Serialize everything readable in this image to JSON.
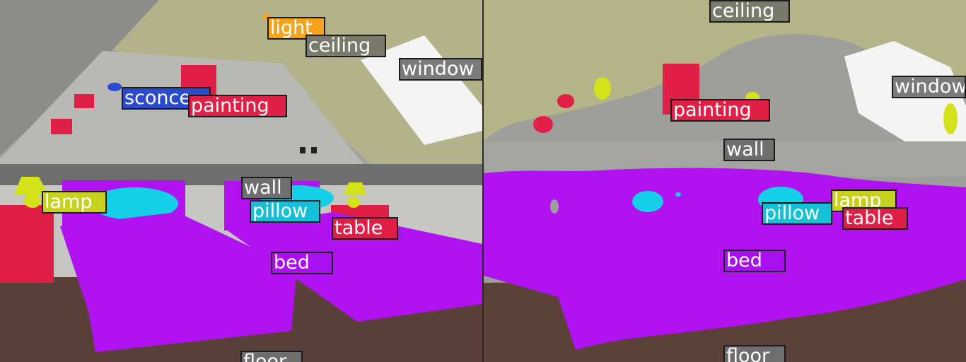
{
  "figure": {
    "panels": [
      {
        "id": "left",
        "labels": [
          {
            "key": "light",
            "text": "light"
          },
          {
            "key": "ceiling",
            "text": "ceiling"
          },
          {
            "key": "window",
            "text": "window"
          },
          {
            "key": "sconce",
            "text": "sconce"
          },
          {
            "key": "painting",
            "text": "painting"
          },
          {
            "key": "wall",
            "text": "wall"
          },
          {
            "key": "lamp",
            "text": "lamp"
          },
          {
            "key": "pillow",
            "text": "pillow"
          },
          {
            "key": "table",
            "text": "table"
          },
          {
            "key": "bed",
            "text": "bed"
          },
          {
            "key": "floor",
            "text": "floor"
          }
        ]
      },
      {
        "id": "right",
        "labels": [
          {
            "key": "ceiling",
            "text": "ceiling"
          },
          {
            "key": "window",
            "text": "window"
          },
          {
            "key": "painting",
            "text": "painting"
          },
          {
            "key": "wall",
            "text": "wall"
          },
          {
            "key": "lamp",
            "text": "lamp"
          },
          {
            "key": "pillow",
            "text": "pillow"
          },
          {
            "key": "table",
            "text": "table"
          },
          {
            "key": "bed",
            "text": "bed"
          },
          {
            "key": "floor",
            "text": "floor"
          }
        ]
      }
    ]
  },
  "class_colors": {
    "light": "#f5a31a",
    "ceiling": "#7a7a6a",
    "window": "#7a7a7a",
    "sconce": "#2a4ad0",
    "painting": "#e01f46",
    "wall": "#6e6e6e",
    "lamp": "#c8d21e",
    "pillow": "#14c0d8",
    "table": "#e01f46",
    "bed": "#a810f0",
    "floor": "#6e6e6e"
  }
}
